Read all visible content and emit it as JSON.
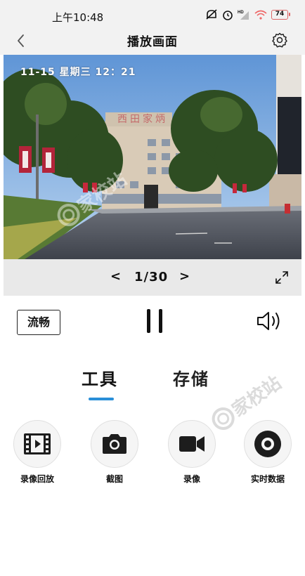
{
  "status_bar": {
    "time": "上午10:48",
    "battery": "74",
    "icons": [
      "mute-icon",
      "alarm-icon",
      "signal-hd-icon",
      "wifi-icon",
      "battery-icon"
    ]
  },
  "nav": {
    "title": "播放画面",
    "back_icon": "chevron-left-icon",
    "settings_icon": "gear-icon"
  },
  "video": {
    "timestamp": "11-15 星期三 12：21",
    "building_sign": "西田家炳"
  },
  "pager": {
    "prev": "<",
    "text": "1/30",
    "next": ">"
  },
  "controls": {
    "quality": "流畅",
    "pause_icon": "pause-icon",
    "volume_icon": "volume-icon"
  },
  "tabs": [
    {
      "label": "工具",
      "active": true
    },
    {
      "label": "存储",
      "active": false
    }
  ],
  "tools": [
    {
      "label": "录像回放",
      "icon": "film-icon"
    },
    {
      "label": "截图",
      "icon": "camera-icon"
    },
    {
      "label": "录像",
      "icon": "video-camera-icon"
    },
    {
      "label": "实时数据",
      "icon": "record-dot-icon"
    }
  ],
  "watermark": "家校站",
  "colors": {
    "accent": "#2a8fd8",
    "bar_background": "#f2f2f2",
    "pager_background": "#e9e9e9"
  }
}
